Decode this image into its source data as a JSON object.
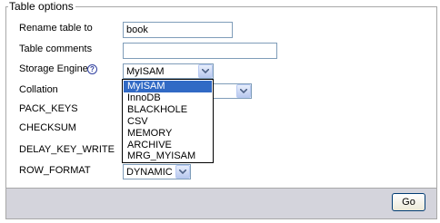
{
  "legend": "Table options",
  "fields": {
    "rename_label": "Rename table to",
    "rename_value": "book",
    "comments_label": "Table comments",
    "comments_value": "",
    "engine_label": "Storage Engine",
    "engine_help": "?",
    "engine_value": "MyISAM",
    "collation_label": "Collation",
    "pack_keys_label": "PACK_KEYS",
    "checksum_label": "CHECKSUM",
    "delay_key_write_label": "DELAY_KEY_WRITE",
    "row_format_label": "ROW_FORMAT",
    "row_format_value": "DYNAMIC"
  },
  "engine_options": [
    "MyISAM",
    "InnoDB",
    "BLACKHOLE",
    "CSV",
    "MEMORY",
    "ARCHIVE",
    "MRG_MYISAM"
  ],
  "go_label": "Go",
  "colors": {
    "selected_option": "#316ac5",
    "footer_bg": "#d4d4dc"
  },
  "icons": {
    "dropdown_arrow": "chevron-down-icon",
    "help": "question-mark-icon"
  }
}
